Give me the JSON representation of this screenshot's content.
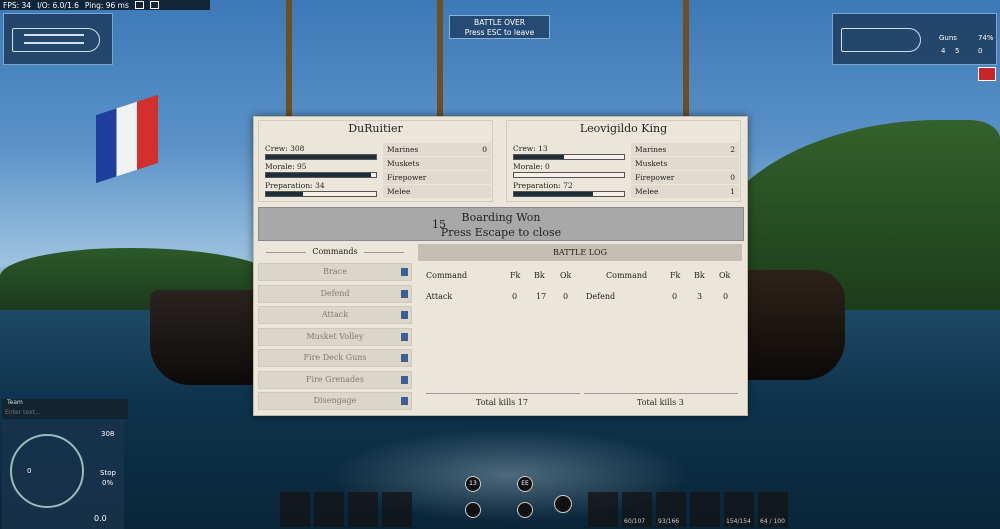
{
  "hud": {
    "fps": "FPS: 34",
    "io": "I/O: 6.0/1.6",
    "ping": "Ping: 96 ms"
  },
  "battle_over": {
    "line1": "BATTLE OVER",
    "line2": "Press ESC to leave"
  },
  "right_panel": {
    "guns": "Guns",
    "percent": "74%",
    "left_count": "4",
    "right_count": "5",
    "zero": "0"
  },
  "left_side": {
    "name": "DuRuitier",
    "crew_label": "Crew: 308",
    "crew_level": 1.0,
    "morale_label": "Morale: 95",
    "morale_level": 0.95,
    "prep_label": "Preparation: 34",
    "prep_level": 0.34,
    "attrs": [
      {
        "label": "Marines",
        "value": "0"
      },
      {
        "label": "Muskets",
        "value": ""
      },
      {
        "label": "Firepower",
        "value": ""
      },
      {
        "label": "Melee",
        "value": ""
      }
    ]
  },
  "right_side": {
    "name": "Leovigildo King",
    "crew_label": "Crew: 13",
    "crew_level": 0.45,
    "morale_label": "Morale: 0",
    "morale_level": 0.0,
    "prep_label": "Preparation: 72",
    "prep_level": 0.72,
    "attrs": [
      {
        "label": "Marines",
        "value": "2"
      },
      {
        "label": "Muskets",
        "value": ""
      },
      {
        "label": "Firepower",
        "value": "0"
      },
      {
        "label": "Melee",
        "value": "1"
      }
    ]
  },
  "banner": {
    "number": "15",
    "line1": "Boarding Won",
    "line2": "Press Escape to close"
  },
  "commands": {
    "title": "Commands",
    "items": [
      "Brace",
      "Defend",
      "Attack",
      "Musket Volley",
      "Fire Deck Guns",
      "Fire Grenades",
      "Disengage"
    ]
  },
  "battle_log": {
    "title": "BATTLE LOG",
    "headers": [
      "Command",
      "Fk",
      "Bk",
      "Ok"
    ],
    "left": {
      "command": "Attack",
      "fk": "0",
      "bk": "17",
      "ok": "0",
      "total": "Total kills 17"
    },
    "right": {
      "command": "Defend",
      "fk": "0",
      "bk": "3",
      "ok": "0",
      "total": "Total kills 3"
    }
  },
  "chat": {
    "team": "Team",
    "placeholder": "Enter text..."
  },
  "helm": {
    "crew": "308",
    "stop": "Stop",
    "pct": "0%",
    "zero": "0",
    "speed": "0.0"
  },
  "bottom": {
    "a": "13",
    "b": "EE",
    "c": "60/107",
    "d": "93/166",
    "e": "154/154",
    "f": "64 / 100"
  },
  "colors": {
    "panel": "#ece6da",
    "banner": "#a8a8a8",
    "meter": "#1e2e3a",
    "hud_blue": "#1e3c5f"
  }
}
